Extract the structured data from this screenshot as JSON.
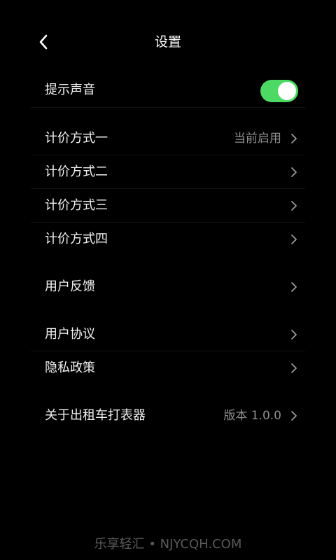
{
  "header": {
    "title": "设置"
  },
  "rows": {
    "sound": {
      "label": "提示声音",
      "enabled": true
    },
    "pricing1": {
      "label": "计价方式一",
      "value": "当前启用"
    },
    "pricing2": {
      "label": "计价方式二"
    },
    "pricing3": {
      "label": "计价方式三"
    },
    "pricing4": {
      "label": "计价方式四"
    },
    "feedback": {
      "label": "用户反馈"
    },
    "agreement": {
      "label": "用户协议"
    },
    "privacy": {
      "label": "隐私政策"
    },
    "about": {
      "label": "关于出租车打表器",
      "value": "版本 1.0.0"
    }
  },
  "footer": {
    "watermark": "乐享轻汇 • NJYCQH.COM"
  },
  "colors": {
    "toggle_on": "#4cd964",
    "background": "#000000"
  }
}
